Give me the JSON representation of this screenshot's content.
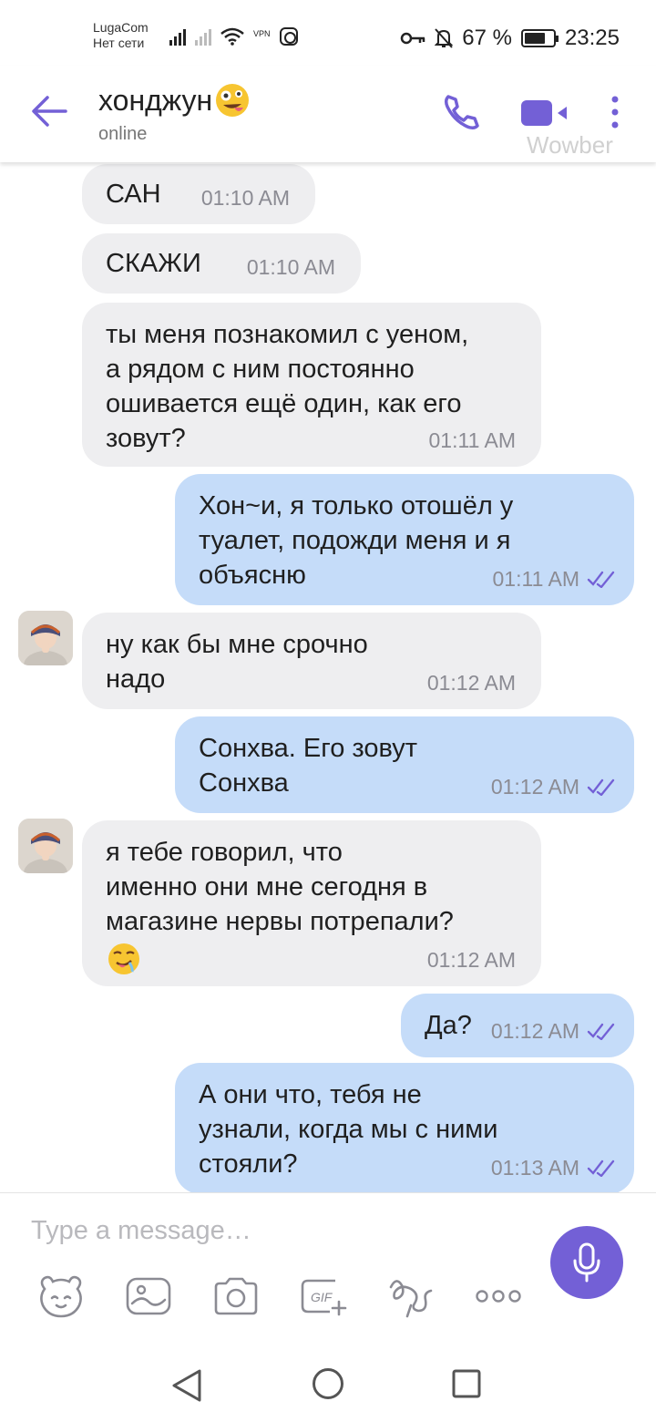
{
  "status_bar": {
    "carrier_name": "LugaCom",
    "carrier_status": "Нет сети",
    "vpn_label": "VPN",
    "battery": "67 %",
    "time": "23:25"
  },
  "header": {
    "contact_name": "хонджун",
    "contact_status": "online",
    "watermark": "Wowber"
  },
  "messages": [
    {
      "direction": "in",
      "text": "САН",
      "time": "01:10 AM"
    },
    {
      "direction": "in",
      "text": "СКАЖИ",
      "time": "01:10 AM"
    },
    {
      "direction": "in",
      "text": "ты меня познакомил с уеном,\nа рядом с ним постоянно\nошивается ещё один, как его\nзовут?",
      "time": "01:11 AM"
    },
    {
      "direction": "out",
      "text": "Хон~и, я только отошёл у\nтуалет, подожди меня и я\nобъясню",
      "time": "01:11 AM"
    },
    {
      "direction": "in",
      "text": "ну как бы мне срочно\nнадо",
      "time": "01:12 AM"
    },
    {
      "direction": "out",
      "text": "Сонхва. Его зовут\nСонхва",
      "time": "01:12 AM"
    },
    {
      "direction": "in",
      "text": "я тебе говорил, что\nименно они мне сегодня в\nмагазине нервы потрепали?",
      "time": "01:12 AM"
    },
    {
      "direction": "out",
      "text": "Да?",
      "time": "01:12 AM"
    },
    {
      "direction": "out",
      "text": "А они что, тебя не\nузнали, когда мы с ними\nстояли?",
      "time": "01:13 AM"
    }
  ],
  "composer": {
    "placeholder": "Type a message…",
    "gif_label": "GIF"
  },
  "colors": {
    "accent": "#7360d6",
    "incoming_bubble": "#eeeef0",
    "outgoing_bubble": "#c5dcf9"
  }
}
